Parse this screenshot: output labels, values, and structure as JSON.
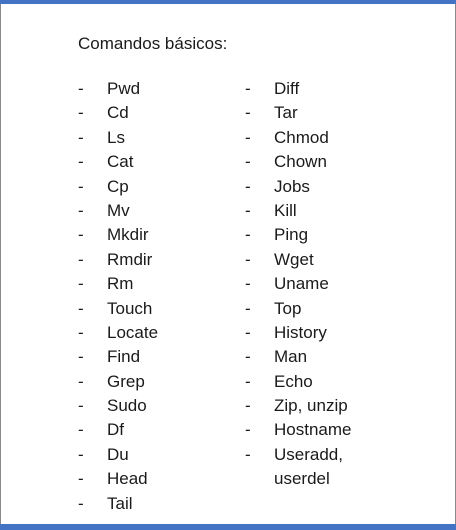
{
  "title": "Comandos básicos:",
  "bullet": "-",
  "left_column": [
    "Pwd",
    "Cd",
    "Ls",
    "Cat",
    "Cp",
    "Mv",
    "Mkdir",
    "Rmdir",
    "Rm",
    "Touch",
    "Locate",
    "Find",
    "Grep",
    "Sudo",
    "Df",
    "Du",
    "Head",
    "Tail"
  ],
  "right_column": [
    "Diff",
    "Tar",
    "Chmod",
    "Chown",
    "Jobs",
    "Kill",
    "Ping",
    "Wget",
    "Uname",
    "Top",
    "History",
    "Man",
    "Echo",
    "Zip, unzip",
    "Hostname",
    "Useradd,"
  ],
  "right_column_continuation": "userdel",
  "colors": {
    "accent_bar": "#4472c4",
    "text": "#1a1a1a"
  }
}
